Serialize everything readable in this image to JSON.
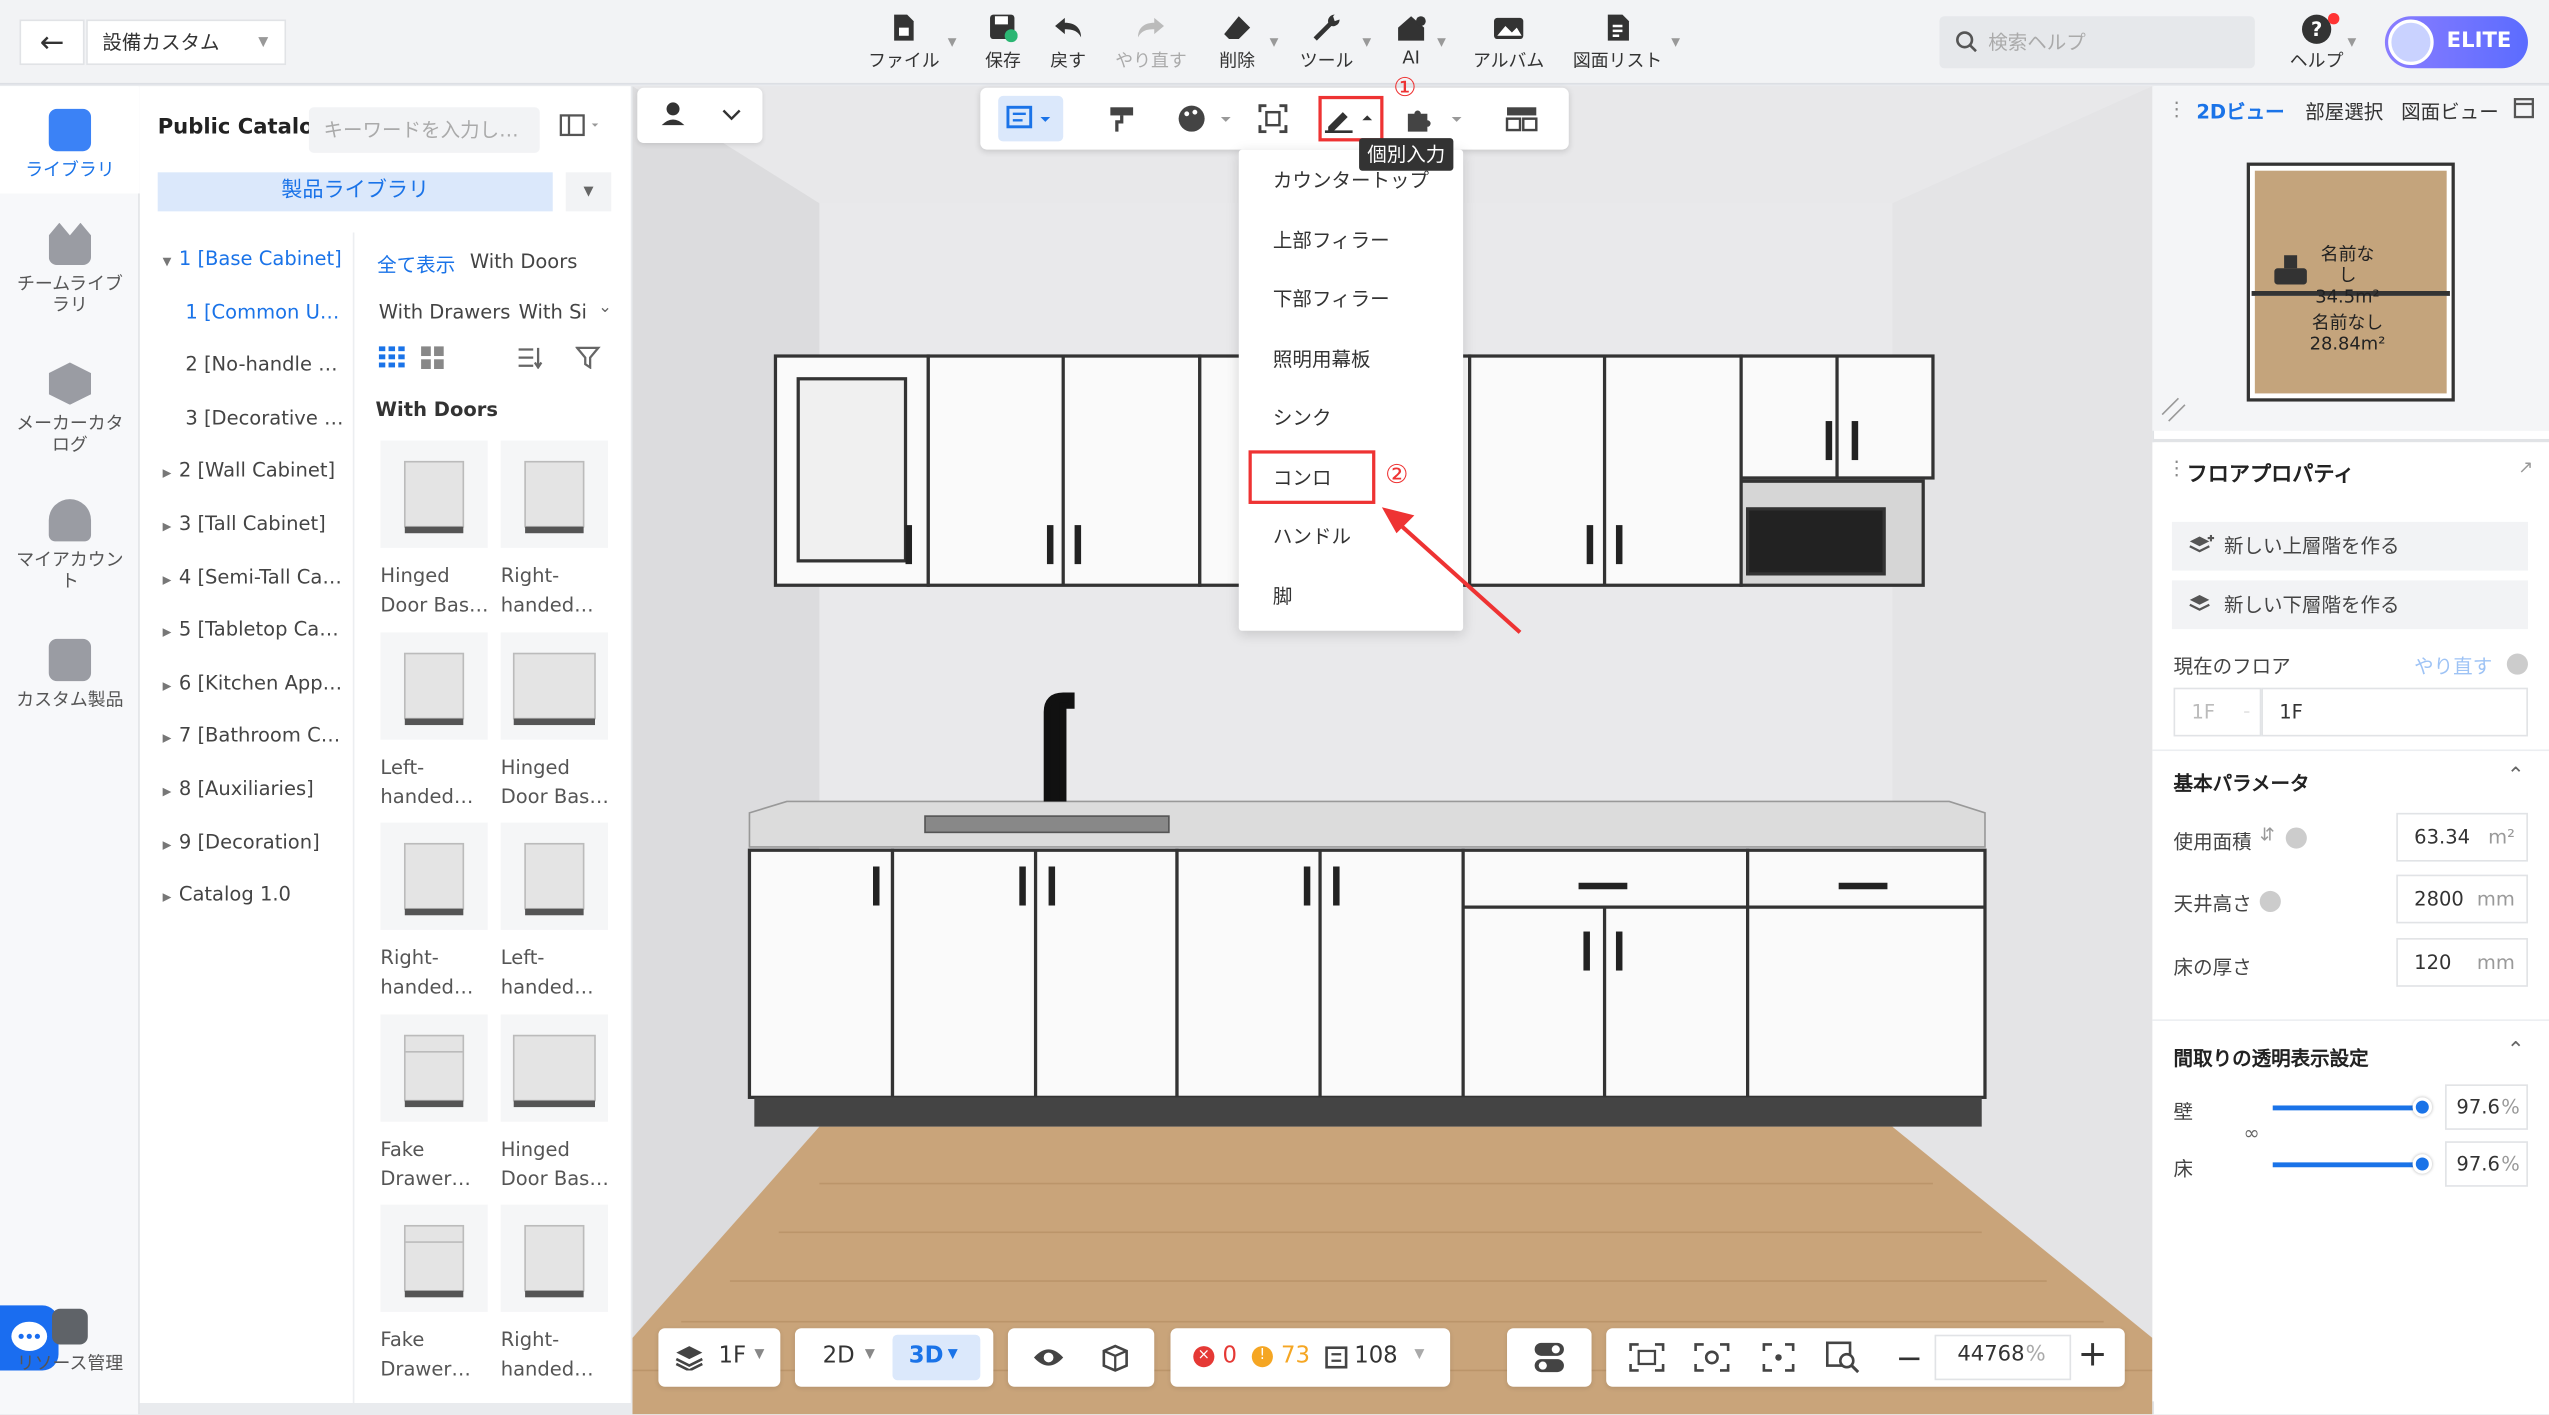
{
  "header": {
    "project_name": "設備カスタム",
    "toolbar": [
      {
        "label": "ファイル",
        "icon": "file-icon"
      },
      {
        "label": "保存",
        "icon": "save-icon"
      },
      {
        "label": "戻す",
        "icon": "undo-icon"
      },
      {
        "label": "やり直す",
        "icon": "redo-icon"
      },
      {
        "label": "削除",
        "icon": "eraser-icon"
      },
      {
        "label": "ツール",
        "icon": "wrench-icon"
      },
      {
        "label": "AI",
        "icon": "ai-house-icon"
      },
      {
        "label": "アルバム",
        "icon": "album-icon"
      },
      {
        "label": "図面リスト",
        "icon": "drawing-list-icon"
      }
    ],
    "search_placeholder": "検索ヘルプ",
    "help_label": "ヘルプ",
    "badge": "ELITE"
  },
  "left_nav": [
    {
      "label": "ライブラリ",
      "active": true
    },
    {
      "label": "チームライブラリ"
    },
    {
      "label": "メーカーカタログ"
    },
    {
      "label": "マイアカウント"
    },
    {
      "label": "カスタム製品"
    },
    {
      "label": "リソース管理"
    }
  ],
  "catalog": {
    "title": "Public Catalog",
    "search_placeholder": "キーワードを入力し…",
    "library_button": "製品ライブラリ",
    "tree": [
      {
        "label": "1 [Base Cabinet]",
        "expanded": true,
        "selected": true
      },
      {
        "label": "1 [Common U…",
        "child": true,
        "selected": true
      },
      {
        "label": "2 [No-handle …",
        "child": true
      },
      {
        "label": "3 [Decorative …",
        "child": true
      },
      {
        "label": "2 [Wall Cabinet]"
      },
      {
        "label": "3 [Tall Cabinet]"
      },
      {
        "label": "4 [Semi-Tall Ca…"
      },
      {
        "label": "5 [Tabletop Ca…"
      },
      {
        "label": "6 [Kitchen App…"
      },
      {
        "label": "7 [Bathroom C…"
      },
      {
        "label": "8 [Auxiliaries]"
      },
      {
        "label": "9 [Decoration]"
      },
      {
        "label": "Catalog 1.0"
      }
    ],
    "filters": [
      "全て表示",
      "With Doors",
      "With Drawers",
      "With Si"
    ],
    "group_label": "With Doors",
    "products": [
      {
        "name": "Hinged\nDoor Bas…"
      },
      {
        "name": "Right-\nhanded…"
      },
      {
        "name": "Left-\nhanded…"
      },
      {
        "name": "Hinged\nDoor Bas…"
      },
      {
        "name": "Right-\nhanded…"
      },
      {
        "name": "Left-\nhanded…"
      },
      {
        "name": "Fake\nDrawer…"
      },
      {
        "name": "Hinged\nDoor Bas…"
      },
      {
        "name": "Fake\nDrawer…"
      },
      {
        "name": "Right-\nhanded…"
      }
    ]
  },
  "canvas": {
    "tooltip": "個別入力",
    "step1": "①",
    "step2": "②",
    "dropdown": [
      "カウンタートップ",
      "上部フィラー",
      "下部フィラー",
      "照明用幕板",
      "シンク",
      "コンロ",
      "ハンドル",
      "脚"
    ],
    "highlighted_item": "コンロ"
  },
  "bottom_bar": {
    "floor": "1F",
    "view_2d": "2D",
    "view_3d": "3D",
    "errors": "0",
    "warnings": "73",
    "items": "108",
    "zoom": "44768",
    "zoom_unit": "%"
  },
  "right_panel": {
    "tabs": [
      "2Dビュー",
      "部屋選択",
      "図面ビュー"
    ],
    "rooms": [
      {
        "name": "名前なし",
        "area": "34.5m²"
      },
      {
        "name": "名前なし",
        "area": "28.84m²"
      }
    ],
    "panel_title": "フロアプロパティ",
    "btn_add_upper": "新しい上層階を作る",
    "btn_add_lower": "新しい下層階を作る",
    "current_floor_label": "現在のフロア",
    "redo_label": "やり直す",
    "floor_select": "1F",
    "floor_value": "1F",
    "basic_params_title": "基本パラメータ",
    "usable_area_label": "使用面積",
    "usable_area": "63.34",
    "usable_area_unit": "m²",
    "ceiling_height_label": "天井高さ",
    "ceiling_height": "2800",
    "ceiling_height_unit": "mm",
    "floor_thickness_label": "床の厚さ",
    "floor_thickness": "120",
    "floor_thickness_unit": "mm",
    "transparency_title": "間取りの透明表示設定",
    "wall_label": "壁",
    "wall_value": "97.6",
    "wall_level_pct": 97.6,
    "floor_label": "床",
    "floor_opacity_value": "97.6",
    "floor_level_pct": 97.6,
    "percent": "%"
  },
  "colors": {
    "accent": "#1a73e8",
    "highlight": "#e53935",
    "elite_gradient": [
      "#8a7dff",
      "#5b6cff"
    ]
  }
}
